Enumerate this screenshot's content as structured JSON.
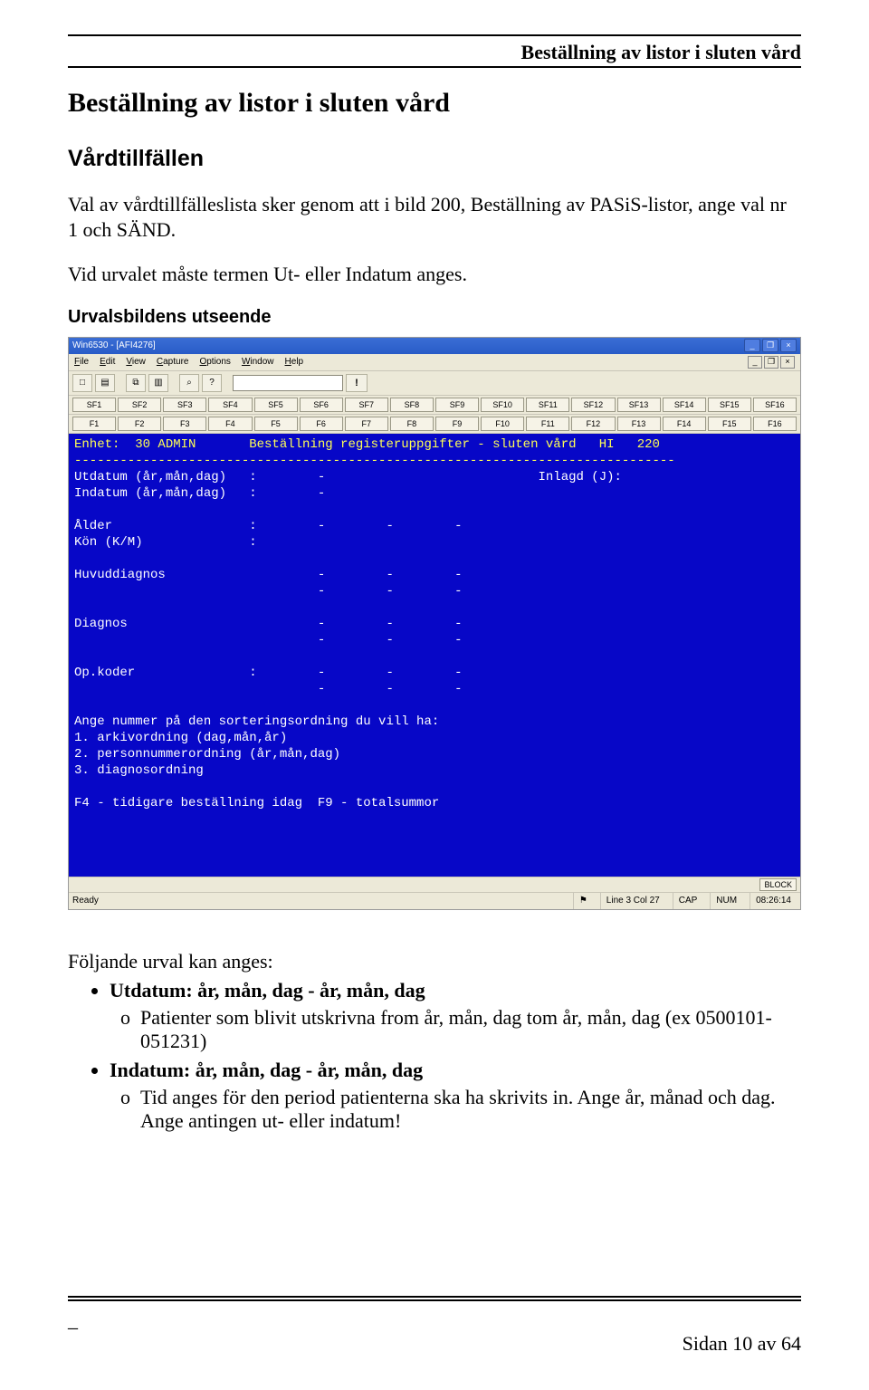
{
  "header": {
    "right_title": "Beställning av listor i sluten vård"
  },
  "h1": "Beställning av listor i sluten vård",
  "section": "Vårdtillfällen",
  "para1": "Val av vårdtillfälleslista sker genom att i bild 200, Beställning av PASiS-listor, ange val nr 1 och SÄND.",
  "para2": "Vid urvalet måste termen Ut- eller Indatum anges.",
  "sub": "Urvalsbildens utseende",
  "win": {
    "title": "Win6530 - [AFI4276]",
    "menus": [
      "File",
      "Edit",
      "View",
      "Capture",
      "Options",
      "Window",
      "Help"
    ],
    "toolbar_icons": [
      "new",
      "open",
      "save",
      "sep",
      "copy",
      "paste",
      "sep",
      "find",
      "help"
    ],
    "sf_row": [
      "SF1",
      "SF2",
      "SF3",
      "SF4",
      "SF5",
      "SF6",
      "SF7",
      "SF8",
      "SF9",
      "SF10",
      "SF11",
      "SF12",
      "SF13",
      "SF14",
      "SF15",
      "SF16"
    ],
    "f_row": [
      "F1",
      "F2",
      "F3",
      "F4",
      "F5",
      "F6",
      "F7",
      "F8",
      "F9",
      "F10",
      "F11",
      "F12",
      "F13",
      "F14",
      "F15",
      "F16"
    ],
    "block_label": "BLOCK",
    "status": {
      "ready": "Ready",
      "line": "Line 3 Col 27",
      "caps": "CAP",
      "num": "NUM",
      "time": "08:26:14"
    }
  },
  "term": {
    "l01_enhet": "Enhet:  30 ADMIN       Beställning registeruppgifter - sluten vård   HI   220",
    "l02_dash": "-------------------------------------------------------------------------------",
    "l03": "Utdatum (år,mån,dag)   :        -                            Inlagd (J):",
    "l04": "Indatum (år,mån,dag)   :        -",
    "l05": "",
    "l06": "Ålder                  :        -        -        -",
    "l07": "Kön (K/M)              :",
    "l08": "",
    "l09": "Huvuddiagnos                    -        -        -",
    "l10": "                                -        -        -",
    "l11": "",
    "l12": "Diagnos                         -        -        -",
    "l13": "                                -        -        -",
    "l14": "",
    "l15": "Op.koder               :        -        -        -",
    "l16": "                                -        -        -",
    "l17": "",
    "l18": "Ange nummer på den sorteringsordning du vill ha:",
    "l19": "1. arkivordning (dag,mån,år)",
    "l20": "2. personnummerordning (år,mån,dag)",
    "l21": "3. diagnosordning",
    "l22": "",
    "l23": "F4 - tidigare beställning idag  F9 - totalsummor"
  },
  "after": {
    "intro": "Följande urval kan anges:",
    "b1_label": "Utdatum: år, mån, dag - år, mån, dag",
    "b1_sub": "Patienter som blivit utskrivna from år, mån, dag tom år, mån, dag (ex 0500101- 051231)",
    "b2_label": "Indatum: år, mån, dag - år, mån, dag",
    "b2_sub": "Tid anges för den period patienterna ska ha skrivits in. Ange år, månad och dag. Ange antingen ut- eller indatum!"
  },
  "footer": {
    "dash": "_",
    "page": "Sidan 10 av 64"
  }
}
